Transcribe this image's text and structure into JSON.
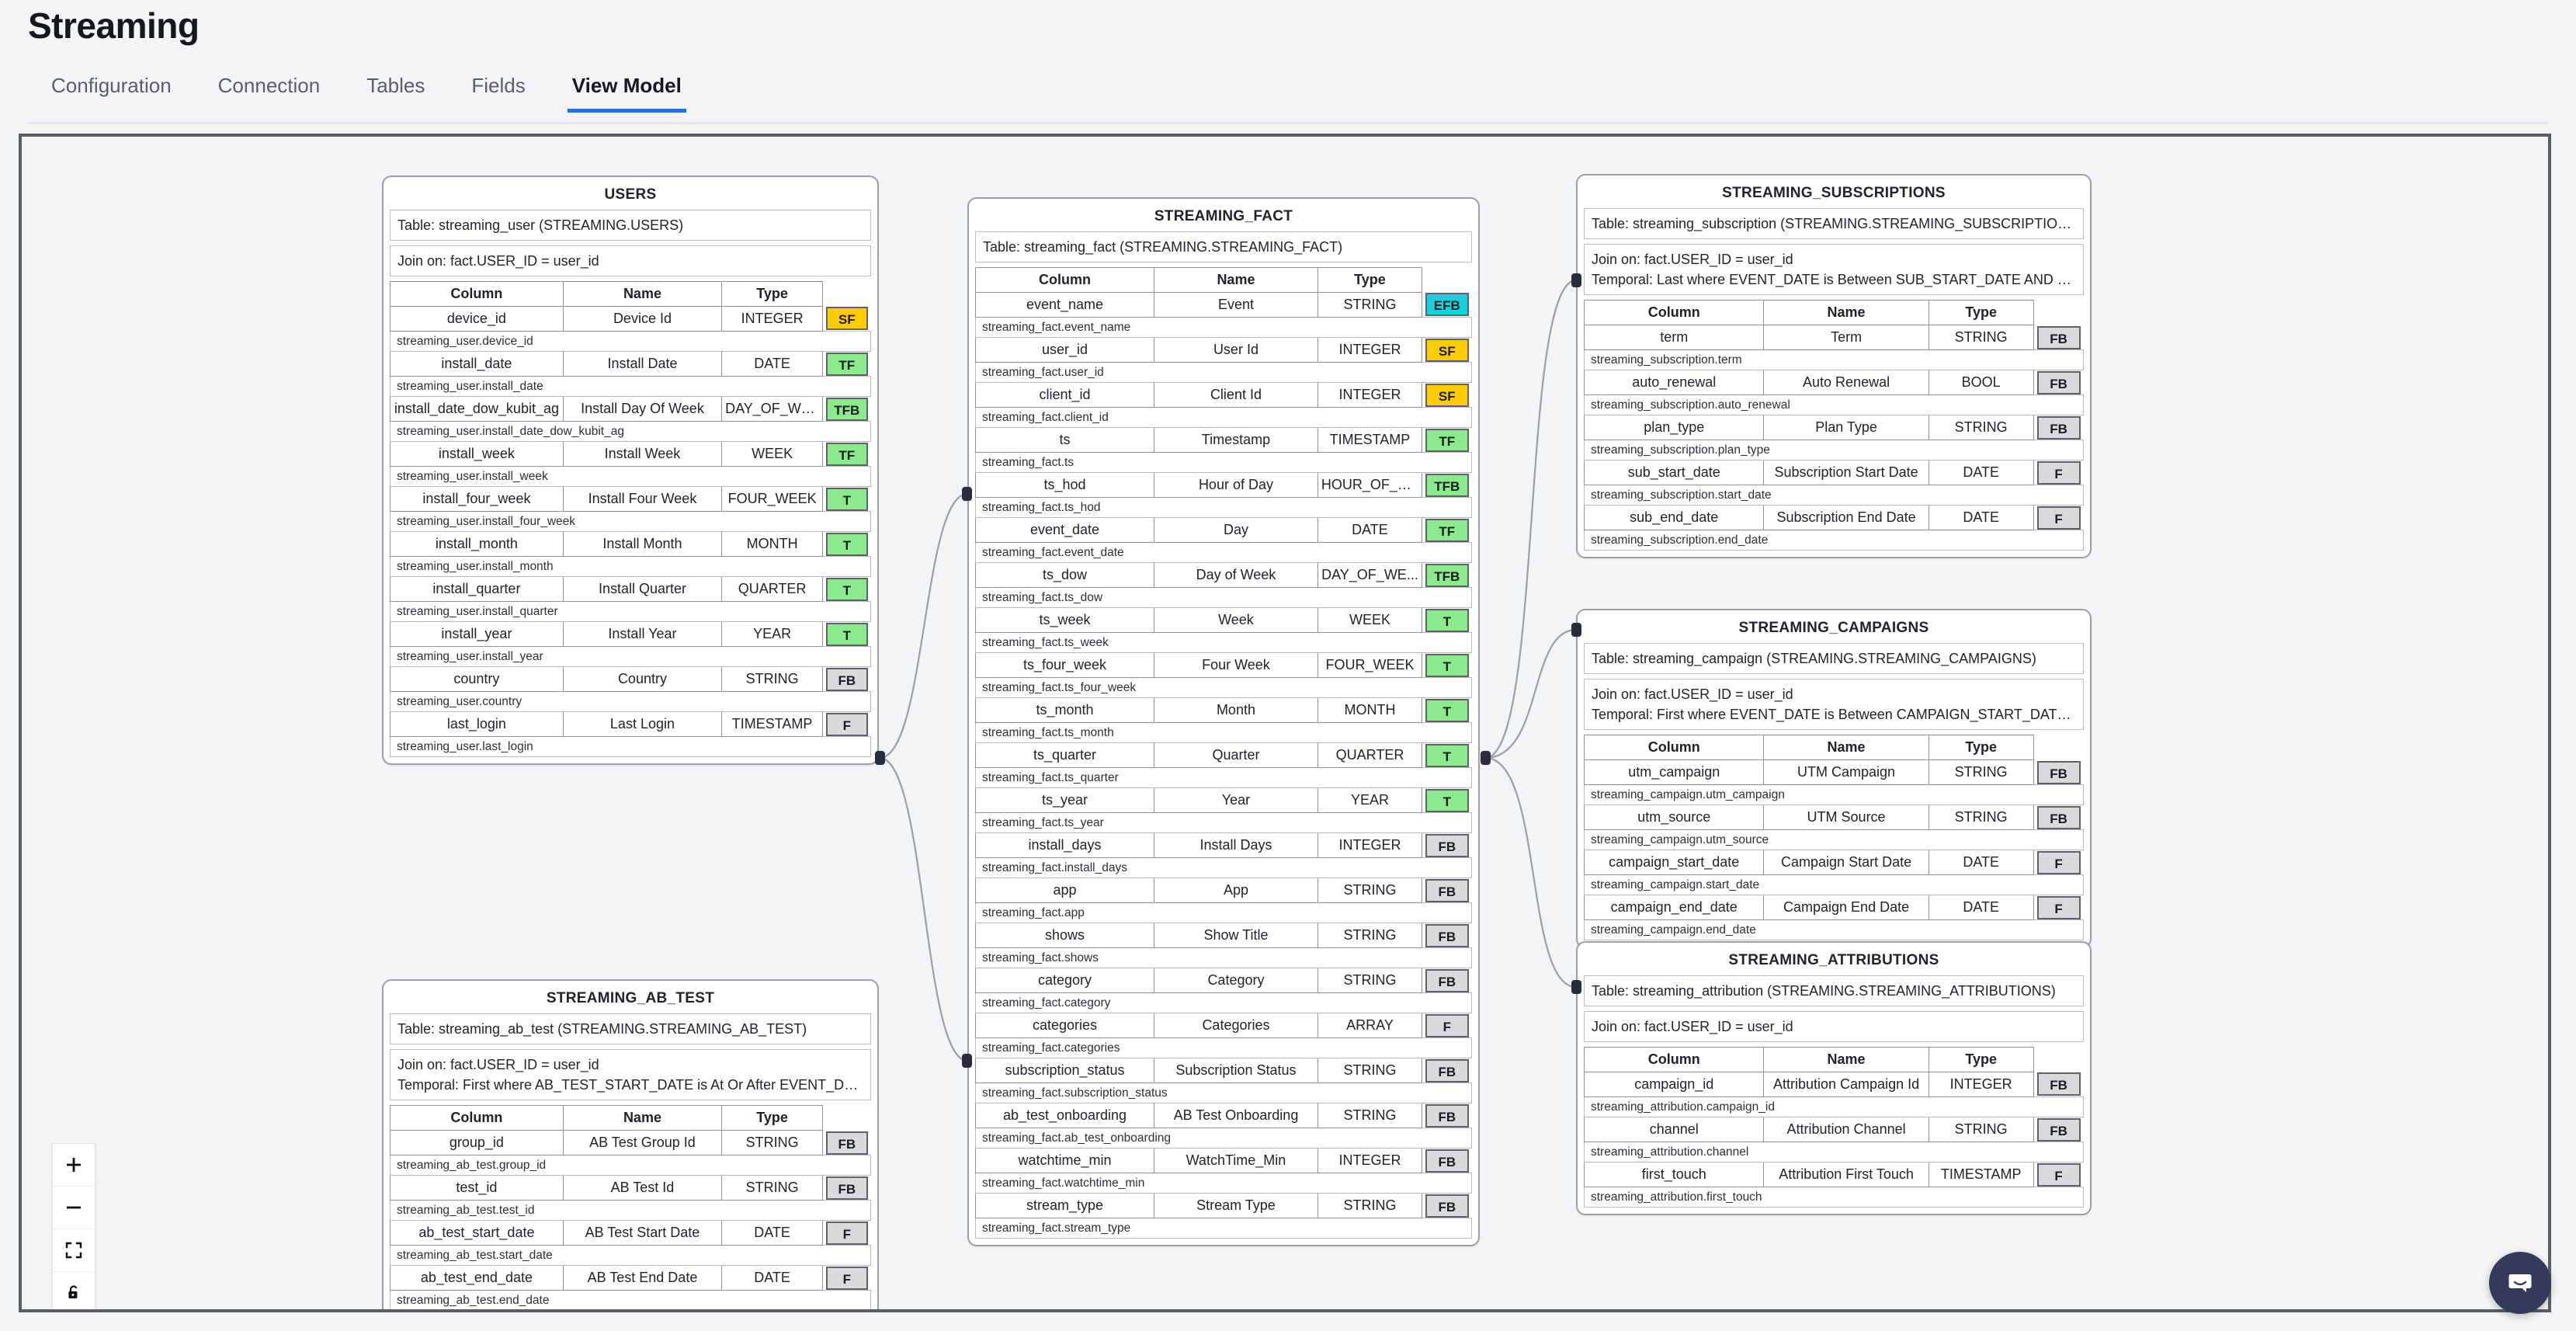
{
  "header": {
    "title": "Streaming",
    "tabs": [
      {
        "label": "Configuration",
        "active": false
      },
      {
        "label": "Connection",
        "active": false
      },
      {
        "label": "Tables",
        "active": false
      },
      {
        "label": "Fields",
        "active": false
      },
      {
        "label": "View Model",
        "active": true
      }
    ],
    "accent_color": "#1a73e8"
  },
  "canvas": {
    "column_headers": [
      "Column",
      "Name",
      "Type"
    ],
    "badge_colors": {
      "SF": "#ffcc00",
      "EFB": "#13d3dd",
      "TF": "#8bea8b",
      "TFB": "#8bea8b",
      "T": "#8bea8b",
      "FB": "#d9dadc",
      "F": "#d9dadc"
    },
    "nodes": [
      {
        "id": "users",
        "title": "USERS",
        "table_line": "Table: streaming_user (STREAMING.USERS)",
        "meta_lines": [
          "Join on: fact.USER_ID = user_id"
        ],
        "rows": [
          {
            "column": "device_id",
            "name": "Device Id",
            "type": "INTEGER",
            "badge": "SF",
            "badge_class": "b-yellow",
            "sub": "streaming_user.device_id"
          },
          {
            "column": "install_date",
            "name": "Install Date",
            "type": "DATE",
            "badge": "TF",
            "badge_class": "b-green",
            "sub": "streaming_user.install_date"
          },
          {
            "column": "install_date_dow_kubit_ag",
            "name": "Install Day Of Week",
            "type": "DAY_OF_WE...",
            "badge": "TFB",
            "badge_class": "b-green",
            "sub": "streaming_user.install_date_dow_kubit_ag"
          },
          {
            "column": "install_week",
            "name": "Install Week",
            "type": "WEEK",
            "badge": "TF",
            "badge_class": "b-green",
            "sub": "streaming_user.install_week"
          },
          {
            "column": "install_four_week",
            "name": "Install Four Week",
            "type": "FOUR_WEEK",
            "badge": "T",
            "badge_class": "b-green",
            "sub": "streaming_user.install_four_week"
          },
          {
            "column": "install_month",
            "name": "Install Month",
            "type": "MONTH",
            "badge": "T",
            "badge_class": "b-green",
            "sub": "streaming_user.install_month"
          },
          {
            "column": "install_quarter",
            "name": "Install Quarter",
            "type": "QUARTER",
            "badge": "T",
            "badge_class": "b-green",
            "sub": "streaming_user.install_quarter"
          },
          {
            "column": "install_year",
            "name": "Install Year",
            "type": "YEAR",
            "badge": "T",
            "badge_class": "b-green",
            "sub": "streaming_user.install_year"
          },
          {
            "column": "country",
            "name": "Country",
            "type": "STRING",
            "badge": "FB",
            "badge_class": "b-grey",
            "sub": "streaming_user.country"
          },
          {
            "column": "last_login",
            "name": "Last Login",
            "type": "TIMESTAMP",
            "badge": "F",
            "badge_class": "b-grey",
            "sub": "streaming_user.last_login"
          }
        ]
      },
      {
        "id": "ab_test",
        "title": "STREAMING_AB_TEST",
        "table_line": "Table: streaming_ab_test (STREAMING.STREAMING_AB_TEST)",
        "meta_lines": [
          "Join on: fact.USER_ID = user_id",
          "Temporal: First where AB_TEST_START_DATE is At Or After EVENT_DATE"
        ],
        "rows": [
          {
            "column": "group_id",
            "name": "AB Test Group Id",
            "type": "STRING",
            "badge": "FB",
            "badge_class": "b-grey",
            "sub": "streaming_ab_test.group_id"
          },
          {
            "column": "test_id",
            "name": "AB Test Id",
            "type": "STRING",
            "badge": "FB",
            "badge_class": "b-grey",
            "sub": "streaming_ab_test.test_id"
          },
          {
            "column": "ab_test_start_date",
            "name": "AB Test Start Date",
            "type": "DATE",
            "badge": "F",
            "badge_class": "b-grey",
            "sub": "streaming_ab_test.start_date"
          },
          {
            "column": "ab_test_end_date",
            "name": "AB Test End Date",
            "type": "DATE",
            "badge": "F",
            "badge_class": "b-grey",
            "sub": "streaming_ab_test.end_date"
          }
        ]
      },
      {
        "id": "fact",
        "title": "STREAMING_FACT",
        "table_line": "Table: streaming_fact (STREAMING.STREAMING_FACT)",
        "meta_lines": [],
        "rows": [
          {
            "column": "event_name",
            "name": "Event",
            "type": "STRING",
            "badge": "EFB",
            "badge_class": "b-cyan",
            "sub": "streaming_fact.event_name"
          },
          {
            "column": "user_id",
            "name": "User Id",
            "type": "INTEGER",
            "badge": "SF",
            "badge_class": "b-yellow",
            "sub": "streaming_fact.user_id"
          },
          {
            "column": "client_id",
            "name": "Client Id",
            "type": "INTEGER",
            "badge": "SF",
            "badge_class": "b-yellow",
            "sub": "streaming_fact.client_id"
          },
          {
            "column": "ts",
            "name": "Timestamp",
            "type": "TIMESTAMP",
            "badge": "TF",
            "badge_class": "b-green",
            "sub": "streaming_fact.ts"
          },
          {
            "column": "ts_hod",
            "name": "Hour of Day",
            "type": "HOUR_OF_D...",
            "badge": "TFB",
            "badge_class": "b-green",
            "sub": "streaming_fact.ts_hod"
          },
          {
            "column": "event_date",
            "name": "Day",
            "type": "DATE",
            "badge": "TF",
            "badge_class": "b-green",
            "sub": "streaming_fact.event_date"
          },
          {
            "column": "ts_dow",
            "name": "Day of Week",
            "type": "DAY_OF_WE...",
            "badge": "TFB",
            "badge_class": "b-green",
            "sub": "streaming_fact.ts_dow"
          },
          {
            "column": "ts_week",
            "name": "Week",
            "type": "WEEK",
            "badge": "T",
            "badge_class": "b-green",
            "sub": "streaming_fact.ts_week"
          },
          {
            "column": "ts_four_week",
            "name": "Four Week",
            "type": "FOUR_WEEK",
            "badge": "T",
            "badge_class": "b-green",
            "sub": "streaming_fact.ts_four_week"
          },
          {
            "column": "ts_month",
            "name": "Month",
            "type": "MONTH",
            "badge": "T",
            "badge_class": "b-green",
            "sub": "streaming_fact.ts_month"
          },
          {
            "column": "ts_quarter",
            "name": "Quarter",
            "type": "QUARTER",
            "badge": "T",
            "badge_class": "b-green",
            "sub": "streaming_fact.ts_quarter"
          },
          {
            "column": "ts_year",
            "name": "Year",
            "type": "YEAR",
            "badge": "T",
            "badge_class": "b-green",
            "sub": "streaming_fact.ts_year"
          },
          {
            "column": "install_days",
            "name": "Install Days",
            "type": "INTEGER",
            "badge": "FB",
            "badge_class": "b-grey",
            "sub": "streaming_fact.install_days"
          },
          {
            "column": "app",
            "name": "App",
            "type": "STRING",
            "badge": "FB",
            "badge_class": "b-grey",
            "sub": "streaming_fact.app"
          },
          {
            "column": "shows",
            "name": "Show Title",
            "type": "STRING",
            "badge": "FB",
            "badge_class": "b-grey",
            "sub": "streaming_fact.shows"
          },
          {
            "column": "category",
            "name": "Category",
            "type": "STRING",
            "badge": "FB",
            "badge_class": "b-grey",
            "sub": "streaming_fact.category"
          },
          {
            "column": "categories",
            "name": "Categories",
            "type": "ARRAY",
            "badge": "F",
            "badge_class": "b-grey",
            "sub": "streaming_fact.categories"
          },
          {
            "column": "subscription_status",
            "name": "Subscription Status",
            "type": "STRING",
            "badge": "FB",
            "badge_class": "b-grey",
            "sub": "streaming_fact.subscription_status"
          },
          {
            "column": "ab_test_onboarding",
            "name": "AB Test Onboarding",
            "type": "STRING",
            "badge": "FB",
            "badge_class": "b-grey",
            "sub": "streaming_fact.ab_test_onboarding"
          },
          {
            "column": "watchtime_min",
            "name": "WatchTime_Min",
            "type": "INTEGER",
            "badge": "FB",
            "badge_class": "b-grey",
            "sub": "streaming_fact.watchtime_min"
          },
          {
            "column": "stream_type",
            "name": "Stream Type",
            "type": "STRING",
            "badge": "FB",
            "badge_class": "b-grey",
            "sub": "streaming_fact.stream_type"
          }
        ]
      },
      {
        "id": "subscriptions",
        "title": "STREAMING_SUBSCRIPTIONS",
        "table_line": "Table: streaming_subscription (STREAMING.STREAMING_SUBSCRIPTIONS)",
        "meta_lines": [
          "Join on: fact.USER_ID = user_id",
          "Temporal: Last where EVENT_DATE is Between SUB_START_DATE AND SUB_END..."
        ],
        "rows": [
          {
            "column": "term",
            "name": "Term",
            "type": "STRING",
            "badge": "FB",
            "badge_class": "b-grey",
            "sub": "streaming_subscription.term"
          },
          {
            "column": "auto_renewal",
            "name": "Auto Renewal",
            "type": "BOOL",
            "badge": "FB",
            "badge_class": "b-grey",
            "sub": "streaming_subscription.auto_renewal"
          },
          {
            "column": "plan_type",
            "name": "Plan Type",
            "type": "STRING",
            "badge": "FB",
            "badge_class": "b-grey",
            "sub": "streaming_subscription.plan_type"
          },
          {
            "column": "sub_start_date",
            "name": "Subscription Start Date",
            "type": "DATE",
            "badge": "F",
            "badge_class": "b-grey",
            "sub": "streaming_subscription.start_date"
          },
          {
            "column": "sub_end_date",
            "name": "Subscription End Date",
            "type": "DATE",
            "badge": "F",
            "badge_class": "b-grey",
            "sub": "streaming_subscription.end_date"
          }
        ]
      },
      {
        "id": "campaigns",
        "title": "STREAMING_CAMPAIGNS",
        "table_line": "Table: streaming_campaign (STREAMING.STREAMING_CAMPAIGNS)",
        "meta_lines": [
          "Join on: fact.USER_ID = user_id",
          "Temporal: First where EVENT_DATE is Between CAMPAIGN_START_DATE AND C..."
        ],
        "rows": [
          {
            "column": "utm_campaign",
            "name": "UTM Campaign",
            "type": "STRING",
            "badge": "FB",
            "badge_class": "b-grey",
            "sub": "streaming_campaign.utm_campaign"
          },
          {
            "column": "utm_source",
            "name": "UTM Source",
            "type": "STRING",
            "badge": "FB",
            "badge_class": "b-grey",
            "sub": "streaming_campaign.utm_source"
          },
          {
            "column": "campaign_start_date",
            "name": "Campaign Start Date",
            "type": "DATE",
            "badge": "F",
            "badge_class": "b-grey",
            "sub": "streaming_campaign.start_date"
          },
          {
            "column": "campaign_end_date",
            "name": "Campaign End Date",
            "type": "DATE",
            "badge": "F",
            "badge_class": "b-grey",
            "sub": "streaming_campaign.end_date"
          }
        ]
      },
      {
        "id": "attributions",
        "title": "STREAMING_ATTRIBUTIONS",
        "table_line": "Table: streaming_attribution (STREAMING.STREAMING_ATTRIBUTIONS)",
        "meta_lines": [
          "Join on: fact.USER_ID = user_id"
        ],
        "rows": [
          {
            "column": "campaign_id",
            "name": "Attribution Campaign Id",
            "type": "INTEGER",
            "badge": "FB",
            "badge_class": "b-grey",
            "sub": "streaming_attribution.campaign_id"
          },
          {
            "column": "channel",
            "name": "Attribution Channel",
            "type": "STRING",
            "badge": "FB",
            "badge_class": "b-grey",
            "sub": "streaming_attribution.channel"
          },
          {
            "column": "first_touch",
            "name": "Attribution First Touch",
            "type": "TIMESTAMP",
            "badge": "F",
            "badge_class": "b-grey",
            "sub": "streaming_attribution.first_touch"
          }
        ]
      }
    ]
  },
  "controls": [
    {
      "icon": "zoom-in-icon",
      "label": "Zoom In"
    },
    {
      "icon": "zoom-out-icon",
      "label": "Zoom Out"
    },
    {
      "icon": "fit-view-icon",
      "label": "Fit View"
    },
    {
      "icon": "unlock-icon",
      "label": "Toggle Interactivity"
    }
  ],
  "chat": {
    "icon": "chat-bubble-icon",
    "color": "#343a5a"
  }
}
